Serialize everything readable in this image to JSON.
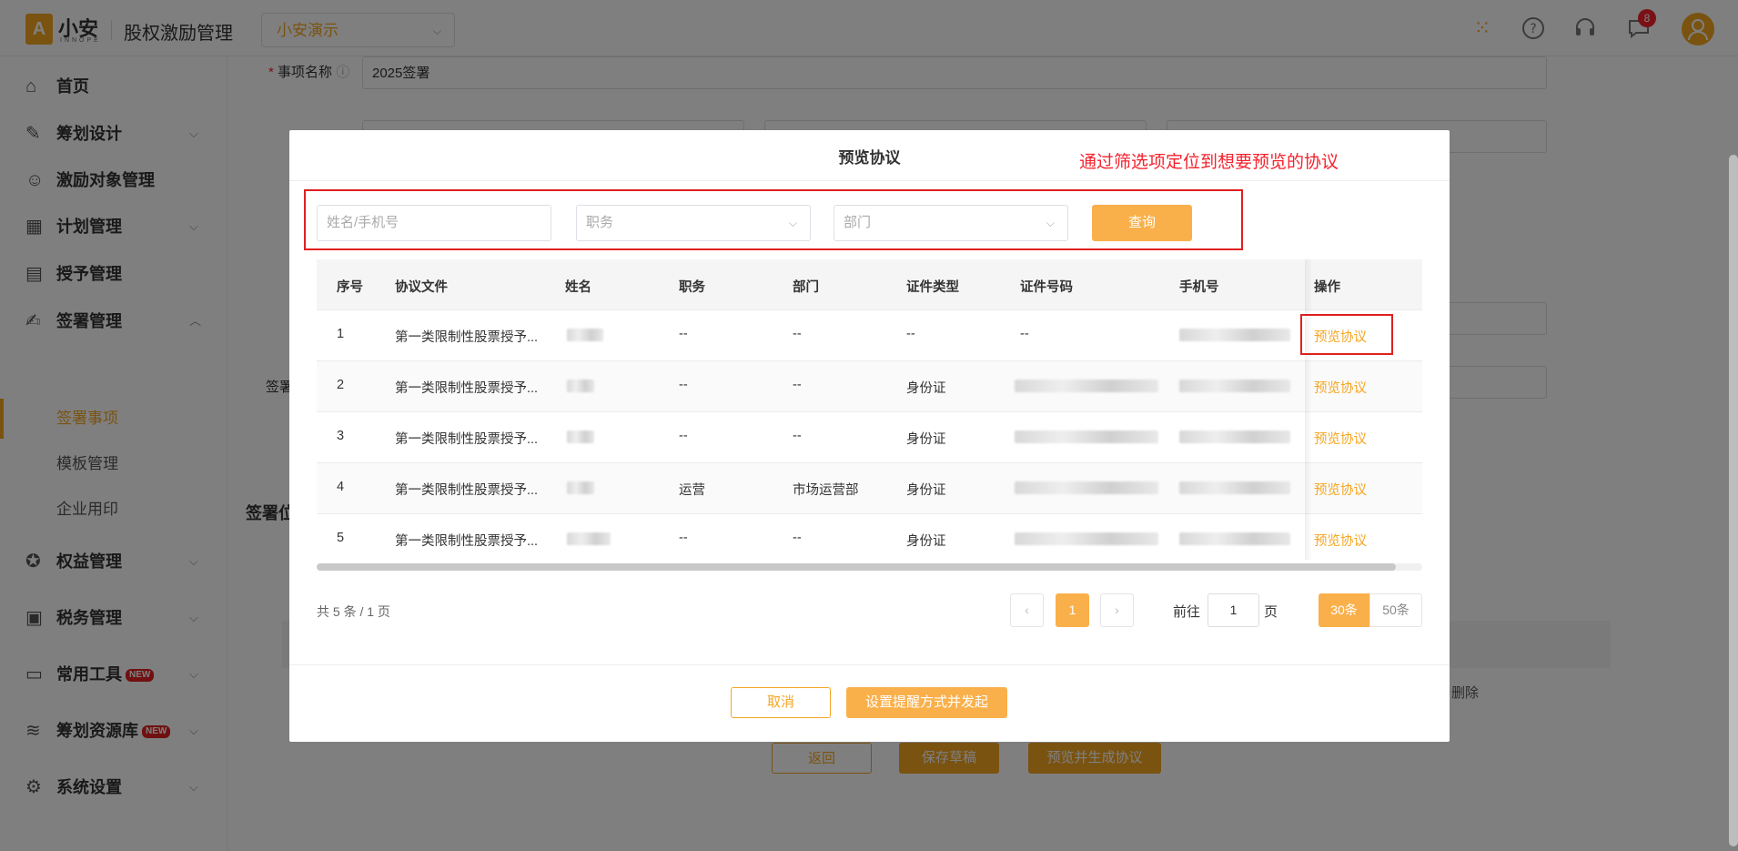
{
  "header": {
    "logo_mark": "A",
    "logo_text": "小安",
    "logo_sub": "INNOPE",
    "app_title": "股权激励管理",
    "company": "小安演示",
    "notification_count": "8"
  },
  "sidebar": {
    "items": [
      {
        "label": "首页",
        "icon": "home-icon"
      },
      {
        "label": "筹划设计",
        "icon": "edit-icon"
      },
      {
        "label": "激励对象管理",
        "icon": "users-icon"
      },
      {
        "label": "计划管理",
        "icon": "grid-icon"
      },
      {
        "label": "授予管理",
        "icon": "book-icon"
      },
      {
        "label": "签署管理",
        "icon": "sign-icon"
      },
      {
        "label": "权益管理",
        "icon": "equity-icon"
      },
      {
        "label": "税务管理",
        "icon": "tax-icon"
      },
      {
        "label": "常用工具",
        "icon": "toolbox-icon",
        "badge": "NEW"
      },
      {
        "label": "筹划资源库",
        "icon": "layers-icon",
        "badge": "NEW"
      },
      {
        "label": "系统设置",
        "icon": "gear-icon"
      }
    ],
    "subitems": [
      "签署事项",
      "模板管理",
      "企业用印"
    ]
  },
  "background_form": {
    "item_name_label": "事项名称",
    "item_name_value": "2025签署",
    "sign_label_partial": "签署",
    "section_partial": "签署位",
    "delete_label": "删除",
    "back_button": "返回",
    "save_draft_button": "保存草稿",
    "preview_generate_button": "预览并生成协议"
  },
  "modal": {
    "title": "预览协议",
    "annotation": "通过筛选项定位到想要预览的协议",
    "filters": {
      "name_placeholder": "姓名/手机号",
      "position_placeholder": "职务",
      "department_placeholder": "部门",
      "query_button": "查询"
    },
    "columns": [
      "序号",
      "协议文件",
      "姓名",
      "职务",
      "部门",
      "证件类型",
      "证件号码",
      "手机号",
      "操作"
    ],
    "rows": [
      {
        "no": "1",
        "file": "第一类限制性股票授予...",
        "position": "--",
        "department": "--",
        "id_type": "--",
        "id_number": "--",
        "action": "预览协议"
      },
      {
        "no": "2",
        "file": "第一类限制性股票授予...",
        "position": "--",
        "department": "--",
        "id_type": "身份证",
        "id_number": "",
        "action": "预览协议"
      },
      {
        "no": "3",
        "file": "第一类限制性股票授予...",
        "position": "--",
        "department": "--",
        "id_type": "身份证",
        "id_number": "",
        "action": "预览协议"
      },
      {
        "no": "4",
        "file": "第一类限制性股票授予...",
        "position": "运营",
        "department": "市场运营部",
        "id_type": "身份证",
        "id_number": "",
        "action": "预览协议"
      },
      {
        "no": "5",
        "file": "第一类限制性股票授予...",
        "position": "--",
        "department": "--",
        "id_type": "身份证",
        "id_number": "",
        "action": "预览协议"
      }
    ],
    "pagination": {
      "summary": "共 5 条 / 1 页",
      "current_page": "1",
      "goto_label": "前往",
      "goto_value": "1",
      "page_unit": "页",
      "size_30": "30条",
      "size_50": "50条"
    },
    "cancel_button": "取消",
    "submit_button": "设置提醒方式并发起"
  }
}
